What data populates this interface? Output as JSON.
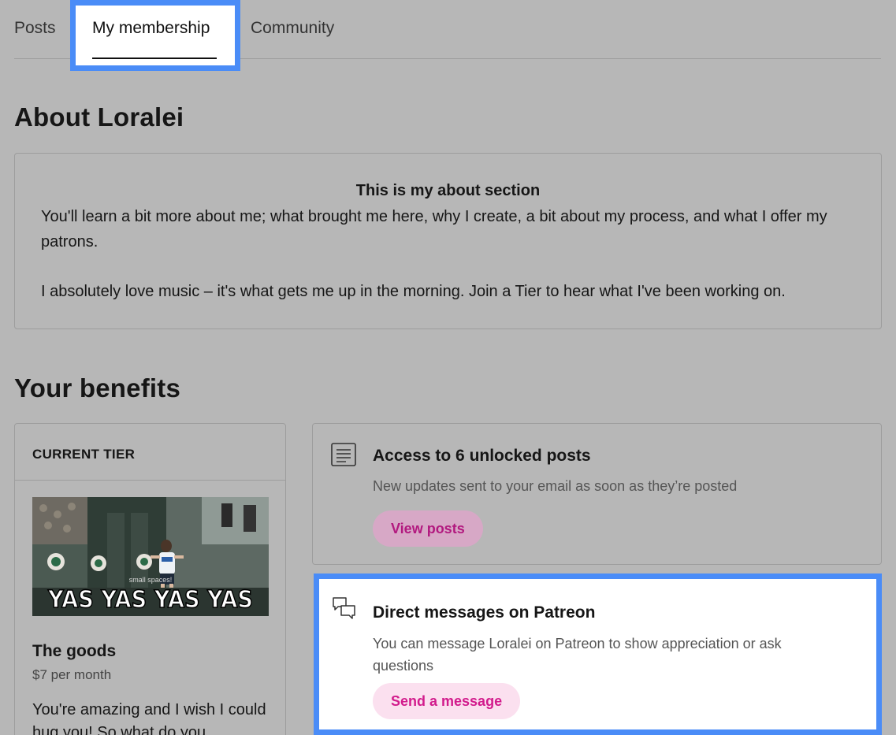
{
  "tabs": {
    "posts": "Posts",
    "membership": "My membership",
    "community": "Community"
  },
  "about": {
    "heading": "About Loralei",
    "title": "This is my about section",
    "p1": "You'll learn a bit more about me; what brought me here, why I create, a bit about my process, and what I offer my patrons.",
    "p2": "I absolutely love music – it's what gets me up in the morning. Join a Tier to hear what I've been working on."
  },
  "benefits": {
    "heading": "Your benefits",
    "tier": {
      "label": "CURRENT TIER",
      "image_caption": "YAS YAS YAS YAS",
      "image_sign": "small spaces!",
      "name": "The goods",
      "price": "$7 per month",
      "description": "You're amazing and I wish I could hug you! So what do you"
    },
    "items": [
      {
        "icon": "document-icon",
        "title": "Access to 6 unlocked posts",
        "description": "New updates sent to your email as soon as they’re posted",
        "button": "View posts"
      },
      {
        "icon": "chat-bubbles-icon",
        "title": "Direct messages on Patreon",
        "description": "You can message Loralei on Patreon to show appreciation or ask questions",
        "button": "Send a message"
      }
    ]
  },
  "colors": {
    "page_background": "#b7b7b7",
    "highlight": "#4a8cf7",
    "pink_text": "#d21b8c",
    "pink_pill": "#fbe0ef"
  }
}
